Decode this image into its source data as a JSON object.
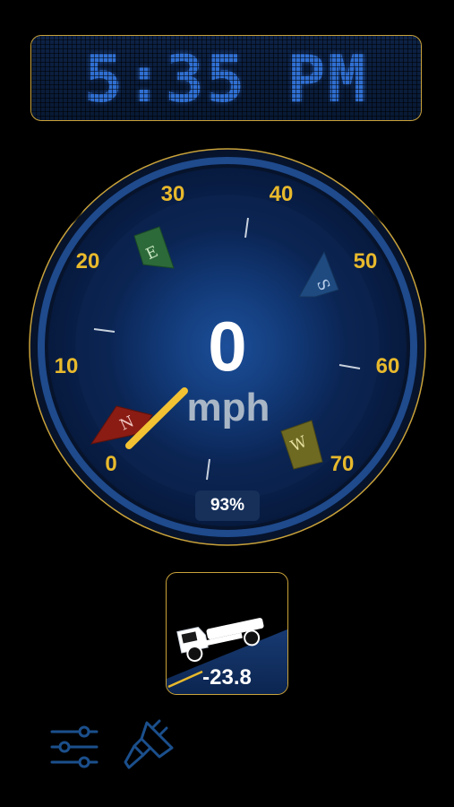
{
  "clock": {
    "time": "5:35 PM"
  },
  "gauge": {
    "speed": "0",
    "unit": "mph",
    "battery": "93%",
    "ticks": [
      "0",
      "10",
      "20",
      "30",
      "40",
      "50",
      "60",
      "70"
    ],
    "compass": {
      "north": "N",
      "east": "E",
      "south": "S",
      "west": "W"
    },
    "colors": {
      "accent": "#e8b92c",
      "ring": "#1f4a8c",
      "face": "#0d2f66",
      "needle": "#f2c233"
    }
  },
  "incline": {
    "value": "-23.8",
    "icon": "truck-icon"
  },
  "toolbar": {
    "settings_icon": "sliders-icon",
    "theme_icon": "paint-brush-icon"
  }
}
